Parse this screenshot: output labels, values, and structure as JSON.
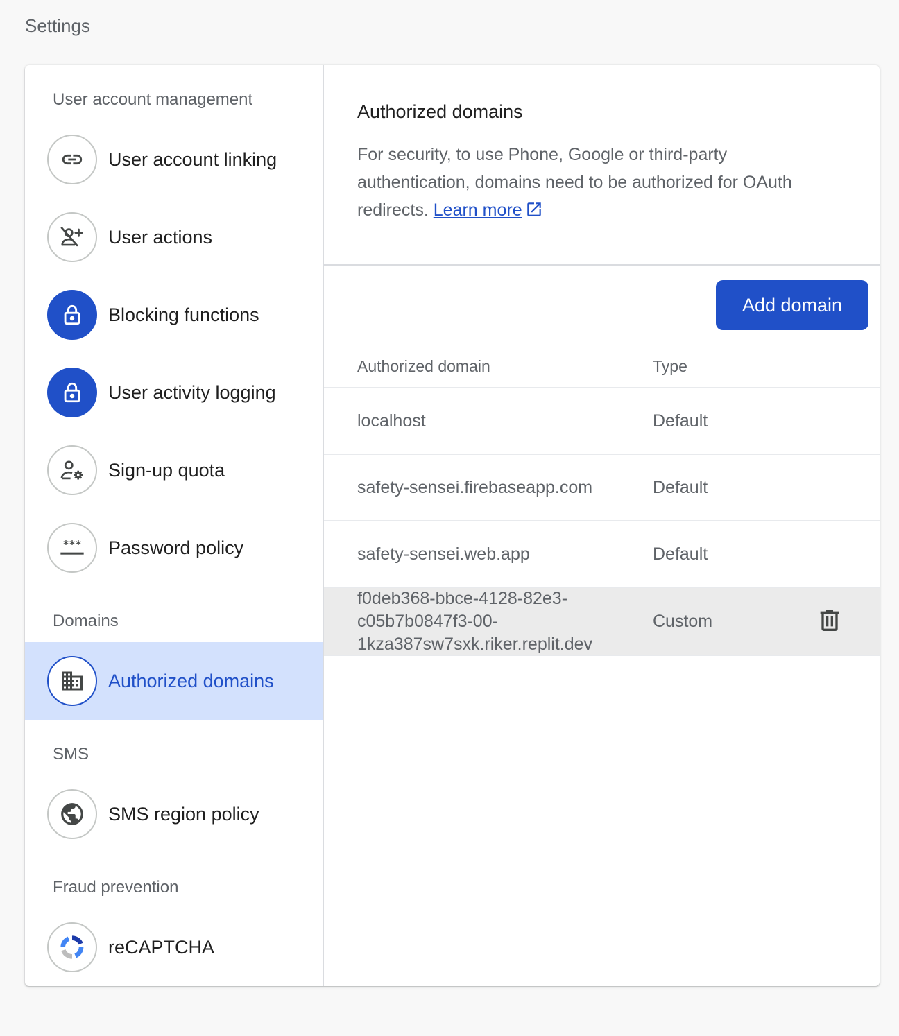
{
  "page": {
    "title": "Settings"
  },
  "sidebar": {
    "sections": [
      {
        "label": "User account management"
      },
      {
        "label": "Domains"
      },
      {
        "label": "SMS"
      },
      {
        "label": "Fraud prevention"
      }
    ],
    "items": [
      {
        "label": "User account linking",
        "icon": "link-icon"
      },
      {
        "label": "User actions",
        "icon": "user-off-add-icon"
      },
      {
        "label": "Blocking functions",
        "icon": "lock-icon"
      },
      {
        "label": "User activity logging",
        "icon": "lock-icon"
      },
      {
        "label": "Sign-up quota",
        "icon": "user-gear-icon"
      },
      {
        "label": "Password policy",
        "icon": "password-icon"
      },
      {
        "label": "Authorized domains",
        "icon": "domain-icon",
        "selected": true
      },
      {
        "label": "SMS region policy",
        "icon": "globe-icon"
      },
      {
        "label": "reCAPTCHA",
        "icon": "recaptcha-icon"
      }
    ]
  },
  "main": {
    "title": "Authorized domains",
    "description": "For security, to use Phone, Google or third-party authentication, domains need to be authorized for OAuth redirects.",
    "learn_more": "Learn more",
    "add_button": "Add domain",
    "table": {
      "headers": [
        "Authorized domain",
        "Type"
      ],
      "rows": [
        {
          "domain": "localhost",
          "type": "Default"
        },
        {
          "domain": "safety-sensei.firebaseapp.com",
          "type": "Default"
        },
        {
          "domain": "safety-sensei.web.app",
          "type": "Default"
        },
        {
          "domain_lines": [
            "f0deb368-bbce-4128-82e3-",
            "c05b7b0847f3-00-",
            "1kza387sw7sxk.riker.replit.dev"
          ],
          "type": "Custom"
        }
      ]
    }
  },
  "colors": {
    "accent": "#2050c8",
    "selected_bg": "#d3e1fd",
    "row_hover": "#ebebeb"
  }
}
